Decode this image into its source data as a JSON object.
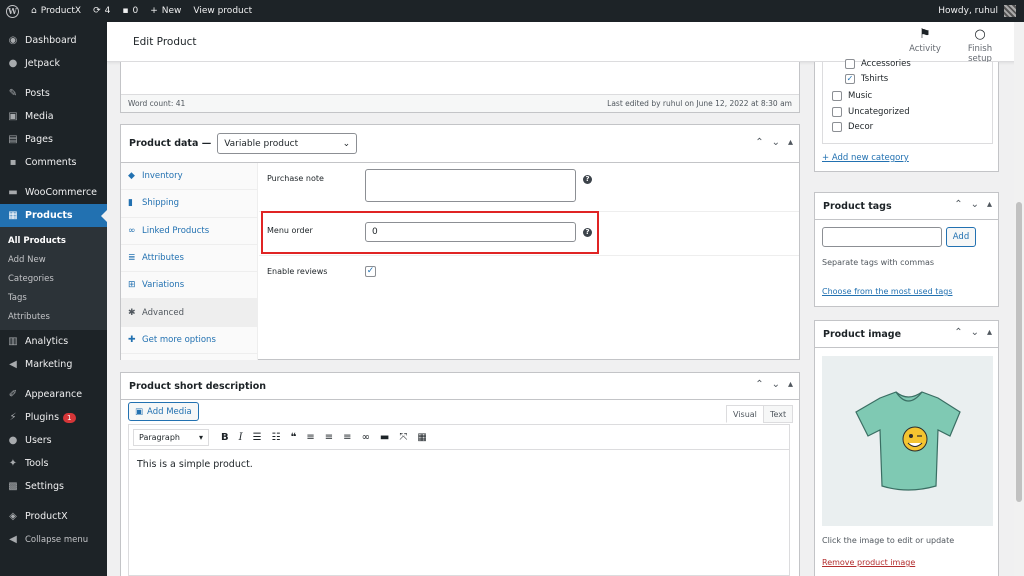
{
  "adminbar": {
    "site_name": "ProductX",
    "updates_count": "4",
    "comments_count": "0",
    "new_label": "New",
    "view_product": "View product",
    "howdy": "Howdy, ruhul"
  },
  "sidebar": {
    "items": [
      {
        "label": "Dashboard",
        "icon": "dashboard-icon"
      },
      {
        "label": "Jetpack",
        "icon": "jetpack-icon"
      },
      {
        "label": "Posts",
        "icon": "pin-icon"
      },
      {
        "label": "Media",
        "icon": "media-icon"
      },
      {
        "label": "Pages",
        "icon": "pages-icon"
      },
      {
        "label": "Comments",
        "icon": "comments-icon"
      },
      {
        "label": "WooCommerce",
        "icon": "woocommerce-icon"
      },
      {
        "label": "Products",
        "icon": "archive-icon"
      },
      {
        "label": "Analytics",
        "icon": "bar-chart-icon"
      },
      {
        "label": "Marketing",
        "icon": "megaphone-icon"
      },
      {
        "label": "Appearance",
        "icon": "brush-icon"
      },
      {
        "label": "Plugins",
        "icon": "plug-icon",
        "badge": "1"
      },
      {
        "label": "Users",
        "icon": "users-icon"
      },
      {
        "label": "Tools",
        "icon": "wrench-icon"
      },
      {
        "label": "Settings",
        "icon": "settings-icon"
      },
      {
        "label": "ProductX",
        "icon": "productx-icon"
      },
      {
        "label": "Collapse menu",
        "icon": "collapse-icon"
      }
    ],
    "submenu": [
      "All Products",
      "Add New",
      "Categories",
      "Tags",
      "Attributes"
    ]
  },
  "header": {
    "title": "Edit Product",
    "activity": "Activity",
    "finish_setup": "Finish setup"
  },
  "editor_status": {
    "word_count": "Word count: 41",
    "last_edited": "Last edited by ruhul on June 12, 2022 at 8:30 am"
  },
  "product_data": {
    "label": "Product data —",
    "type": "Variable product",
    "tabs": [
      "Inventory",
      "Shipping",
      "Linked Products",
      "Attributes",
      "Variations",
      "Advanced",
      "Get more options"
    ],
    "purchase_note_label": "Purchase note",
    "purchase_note_value": "",
    "menu_order_label": "Menu order",
    "menu_order_value": "0",
    "enable_reviews_label": "Enable reviews",
    "enable_reviews_checked": true
  },
  "short_description": {
    "title": "Product short description",
    "add_media": "Add Media",
    "visual_tab": "Visual",
    "text_tab": "Text",
    "format_select": "Paragraph",
    "content": "This is a simple product."
  },
  "categories": {
    "items": [
      {
        "label": "Accessories",
        "checked": false
      },
      {
        "label": "Tshirts",
        "checked": true
      },
      {
        "label": "Music",
        "checked": false
      },
      {
        "label": "Uncategorized",
        "checked": false
      },
      {
        "label": "Decor",
        "checked": false
      }
    ],
    "add_new": "+ Add new category"
  },
  "product_tags": {
    "title": "Product tags",
    "input_value": "",
    "add_button": "Add",
    "hint": "Separate tags with commas",
    "choose_link": "Choose from the most used tags"
  },
  "product_image": {
    "title": "Product image",
    "hint": "Click the image to edit or update",
    "remove_link": "Remove product image"
  },
  "colors": {
    "admin_dark": "#1d2327",
    "accent": "#2271b1",
    "highlight": "#e02424",
    "tshirt": "#7fc9b3"
  }
}
